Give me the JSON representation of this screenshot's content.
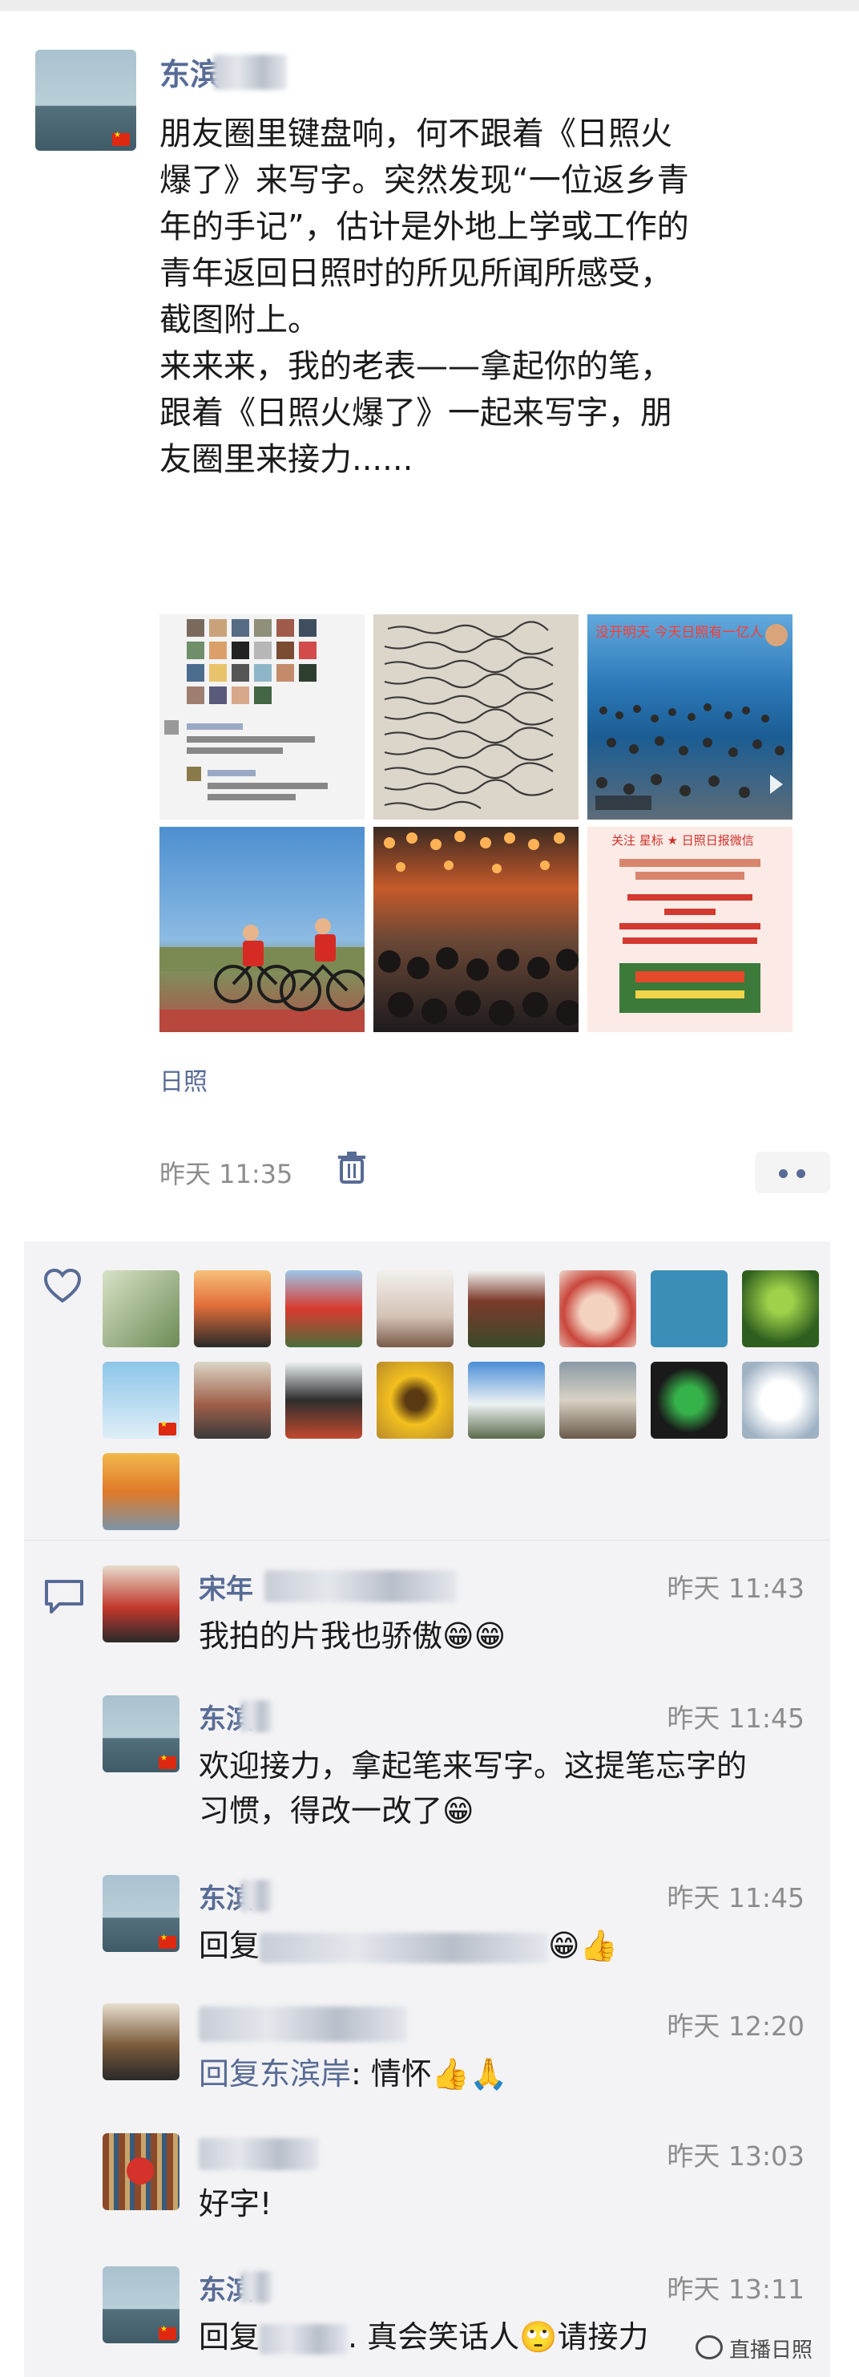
{
  "post": {
    "author": "东滨",
    "text_lines": [
      "朋友圈里键盘响，何不跟着《日照火",
      "爆了》来写字。突然发现“一位返乡青",
      "年的手记”，估计是外地上学或工作的",
      "青年返回日照时的所见所闻所感受，",
      "截图附上。",
      "来来来，我的老表——拿起你的笔，",
      "跟着《日照火爆了》一起来写字，朋",
      "友圈里来接力......"
    ],
    "images": [
      {
        "desc": "screenshot-comments",
        "caption": ""
      },
      {
        "desc": "handwritten-letter",
        "caption": ""
      },
      {
        "desc": "beach-crowd",
        "caption": "没开明天 今天日照有一亿人"
      },
      {
        "desc": "cyclists",
        "caption": ""
      },
      {
        "desc": "night-market-crowd",
        "caption": ""
      },
      {
        "desc": "poster",
        "caption": "关注 星标 ★ 日照日报微信"
      }
    ],
    "location": "日照",
    "time": "昨天 11:35"
  },
  "comments": [
    {
      "name": "宋年",
      "time": "昨天 11:43",
      "text": "我拍的片我也骄傲😁😁",
      "reply_to": ""
    },
    {
      "name": "东滨",
      "time": "昨天 11:45",
      "text": "欢迎接力，拿起笔来写字。这提笔忘字的习惯，得改一改了😁",
      "reply_to": ""
    },
    {
      "name": "东滨",
      "time": "昨天 11:45",
      "text": "😁👍",
      "reply_to": "回复"
    },
    {
      "name": "",
      "time": "昨天 12:20",
      "text": ": 情怀👍🙏",
      "reply_to": "回复东滨岸"
    },
    {
      "name": "",
      "time": "昨天 13:03",
      "text": "好字!",
      "reply_to": ""
    },
    {
      "name": "东滨",
      "time": "昨天 13:11",
      "text": ". 真会笑话人🙄请接力",
      "reply_to": "回复"
    }
  ],
  "watermark": "直播日照",
  "colors": {
    "link": "#576b95",
    "panel": "#f3f3f5",
    "time": "#8c8c8c"
  }
}
